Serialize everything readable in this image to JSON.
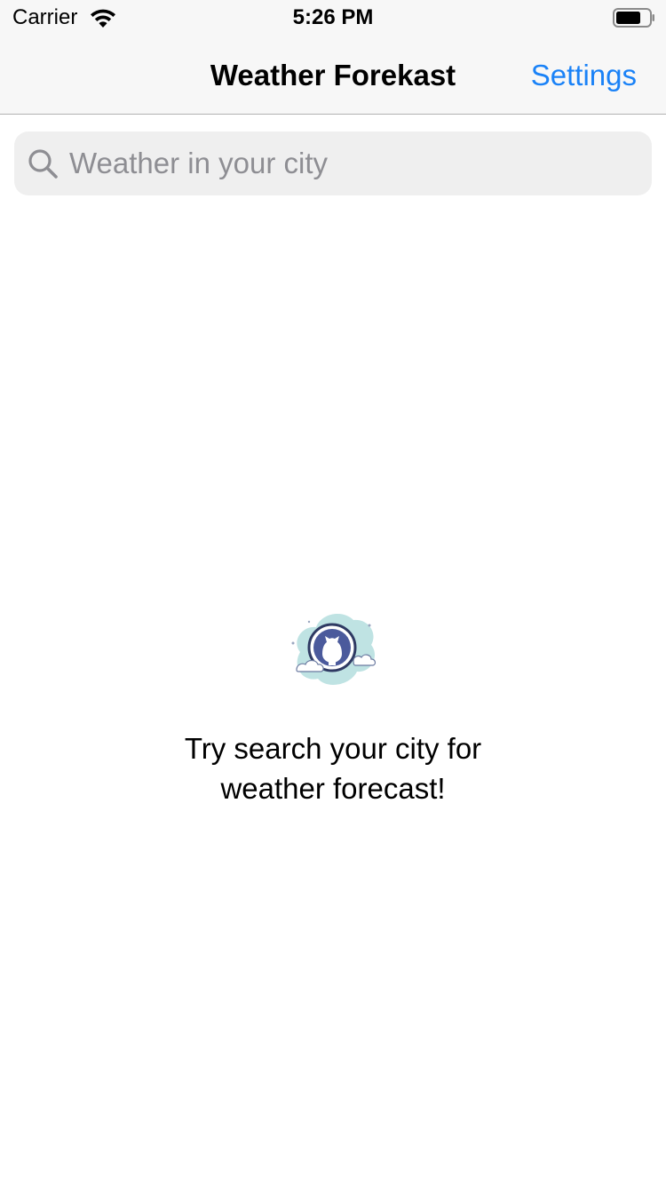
{
  "status_bar": {
    "carrier": "Carrier",
    "time": "5:26 PM",
    "wifi_icon": "wifi-icon",
    "battery_icon": "battery-icon",
    "battery_level": 0.75
  },
  "nav": {
    "title": "Weather Forekast",
    "settings_label": "Settings"
  },
  "search": {
    "placeholder": "Weather in your city",
    "value": "",
    "icon": "search-icon"
  },
  "empty_state": {
    "icon": "octocat-globe-illustration",
    "message_line1": "Try search your city for",
    "message_line2": "weather forecast!"
  },
  "colors": {
    "accent": "#1a82f7",
    "bar_background": "#f7f7f7",
    "search_background": "#efefef",
    "placeholder": "#8e8e93"
  }
}
